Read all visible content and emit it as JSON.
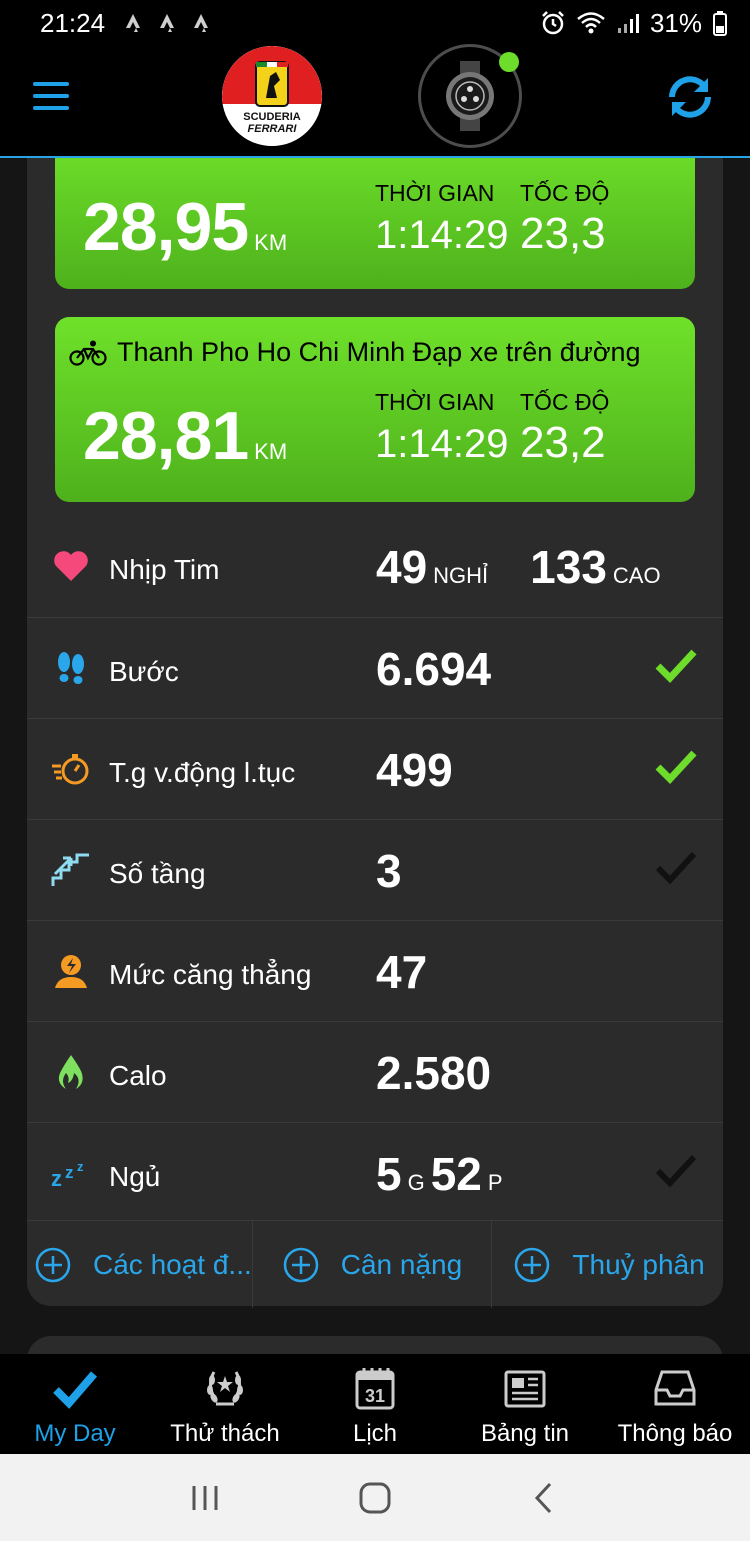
{
  "status_bar": {
    "time": "21:24",
    "battery": "31%"
  },
  "header": {
    "logo_text_top": "SCUDERIA",
    "logo_text_bottom": "FERRARI",
    "device_status_color": "#6edc2b"
  },
  "activities": [
    {
      "title": "",
      "distance": "28,95",
      "unit": "KM",
      "time_label": "THỜI GIAN",
      "time_value": "1:14:29",
      "speed_label": "TỐC ĐỘ",
      "speed_value": "23,3"
    },
    {
      "title": "Thanh Pho Ho Chi Minh Đạp xe trên đường",
      "distance": "28,81",
      "unit": "KM",
      "time_label": "THỜI GIAN",
      "time_value": "1:14:29",
      "speed_label": "TỐC ĐỘ",
      "speed_value": "23,2"
    }
  ],
  "metrics": {
    "heart": {
      "label": "Nhịp Tim",
      "resting": "49",
      "resting_unit": "NGHỈ",
      "high": "133",
      "high_unit": "CAO"
    },
    "steps": {
      "label": "Bước",
      "value": "6.694"
    },
    "intensity": {
      "label": "T.g v.động l.tục",
      "value": "499"
    },
    "floors": {
      "label": "Số tầng",
      "value": "3"
    },
    "stress": {
      "label": "Mức căng thẳng",
      "value": "47"
    },
    "calories": {
      "label": "Calo",
      "value": "2.580"
    },
    "sleep": {
      "label": "Ngủ",
      "hours": "5",
      "hours_unit": "G",
      "minutes": "52",
      "minutes_unit": "P"
    }
  },
  "shortcuts": [
    {
      "label": "Các hoạt đ..."
    },
    {
      "label": "Cân nặng"
    },
    {
      "label": "Thuỷ phân"
    }
  ],
  "tabs": [
    {
      "label": "My Day",
      "icon": "check-icon"
    },
    {
      "label": "Thử thách",
      "icon": "laurel-icon"
    },
    {
      "label": "Lịch",
      "icon": "calendar-icon",
      "day": "31"
    },
    {
      "label": "Bảng tin",
      "icon": "news-icon"
    },
    {
      "label": "Thông báo",
      "icon": "inbox-icon"
    }
  ],
  "colors": {
    "accent": "#1ea1e8",
    "activity_green": "#5cc81f",
    "check_green": "#6edc2b",
    "panel_bg": "#2b2b2b"
  }
}
